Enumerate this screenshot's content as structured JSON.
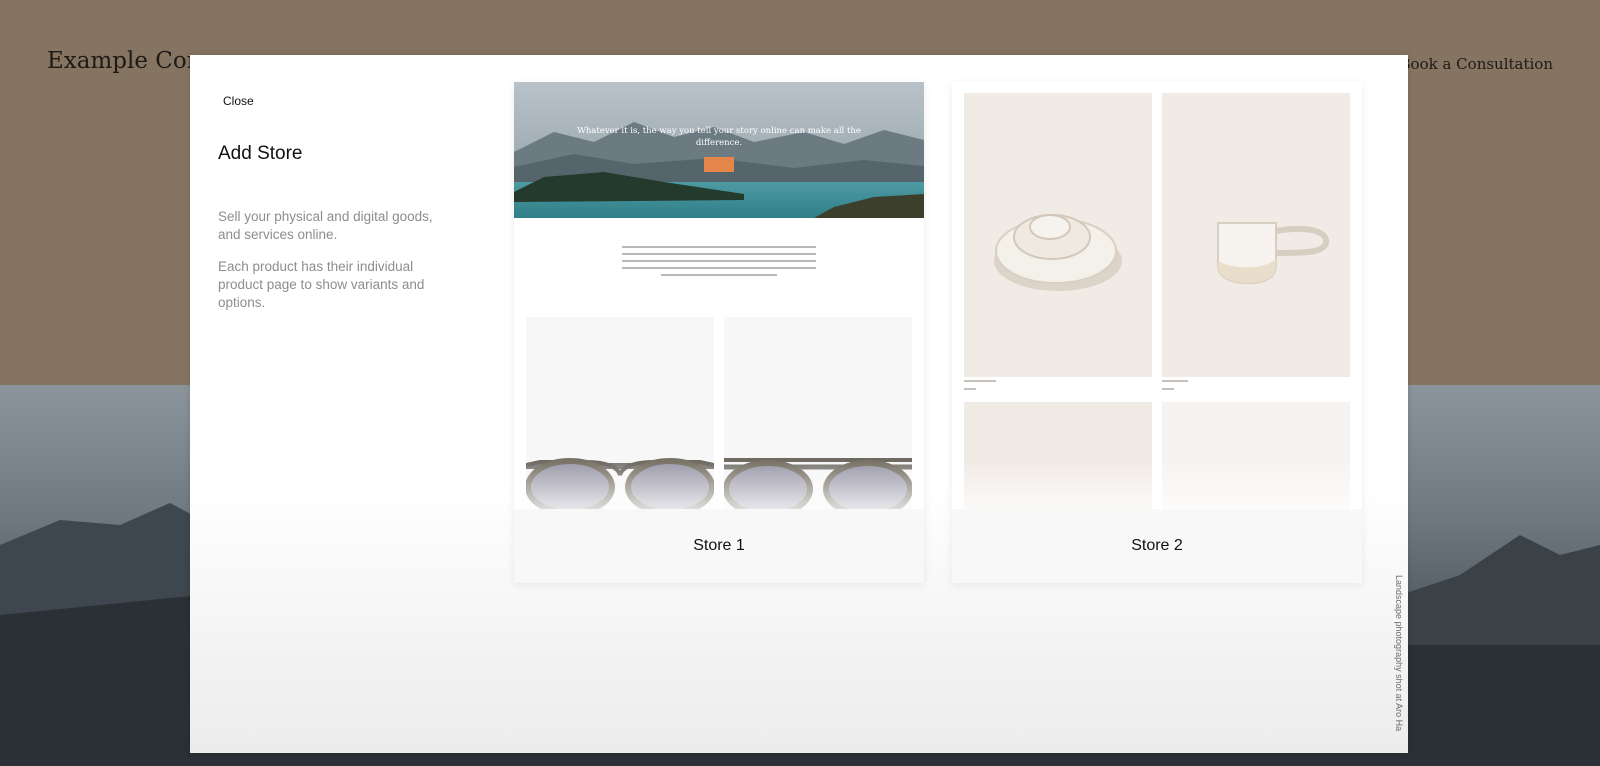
{
  "site": {
    "title": "Example Com",
    "cta": "Book a Consultation",
    "photo_credit": "Landscape photography shot at Aro Ha"
  },
  "modal": {
    "close_label": "Close",
    "title": "Add Store",
    "description_1": "Sell your physical and digital goods, and services online.",
    "description_2": "Each product has their individual product page to show variants and options."
  },
  "stores": [
    {
      "label": "Store 1",
      "preview": {
        "hero_text": "Whatever it is, the way you tell your story online can make all the difference."
      }
    },
    {
      "label": "Store 2"
    }
  ],
  "colors": {
    "site_background": "#857462",
    "hero_button": "#e4864a",
    "product_background": "#f1ebe6"
  }
}
